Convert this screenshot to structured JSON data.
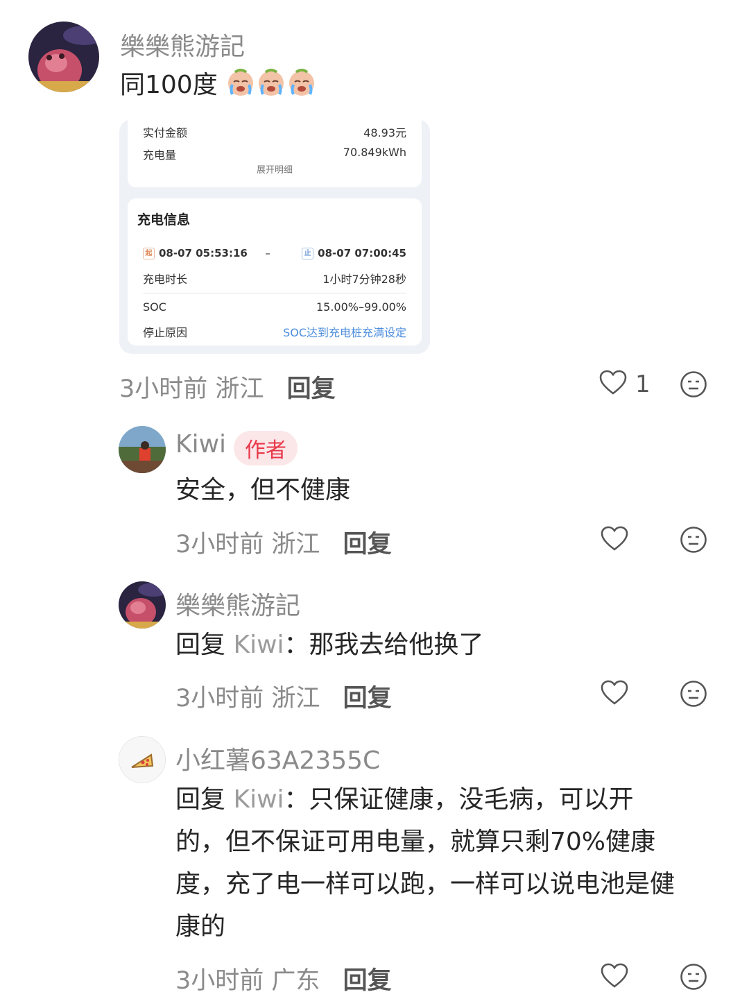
{
  "comments": [
    {
      "username": "樂樂熊游記",
      "text": "同100度",
      "emojis": [
        "crying-face",
        "crying-face",
        "crying-face"
      ],
      "time": "3小时前",
      "location": "浙江",
      "reply_label": "回复",
      "like_count": "1"
    },
    {
      "username": "Kiwi",
      "badge": "作者",
      "text": "安全，但不健康",
      "time": "3小时前",
      "location": "浙江",
      "reply_label": "回复"
    },
    {
      "username": "樂樂熊游記",
      "reply_prefix": "回复",
      "reply_target": "Kiwi",
      "text": "：那我去给他换了",
      "time": "3小时前",
      "location": "浙江",
      "reply_label": "回复"
    },
    {
      "username": "小红薯63A2355C",
      "reply_prefix": "回复",
      "reply_target": "Kiwi",
      "lines": [
        "：只保证健康，没毛病，可以开",
        "的，但不保证可用电量，就算只剩70%健康",
        "度，充了电一样可以跑，一样可以说电池是健",
        "康的"
      ],
      "time": "3小时前",
      "location": "广东",
      "reply_label": "回复"
    }
  ],
  "card": {
    "paid_label": "实付金额",
    "paid_value": "48.93元",
    "energy_label": "充电量",
    "energy_value": "70.849kWh",
    "expand_label": "展开明细",
    "info_title": "充电信息",
    "start_tag": "起",
    "start_time": "08-07 05:53:16",
    "dash": "–",
    "end_tag": "止",
    "end_time": "08-07 07:00:45",
    "duration_label": "充电时长",
    "duration_value": "1小时7分钟28秒",
    "soc_label": "SOC",
    "soc_value": "15.00%–99.00%",
    "stop_label": "停止原因",
    "stop_value": "SOC达到充电桩充满设定"
  },
  "colors": {
    "author_badge_bg": "#fbe6e8",
    "author_badge_text": "#e9374a",
    "link_blue": "#4a8cdc"
  }
}
